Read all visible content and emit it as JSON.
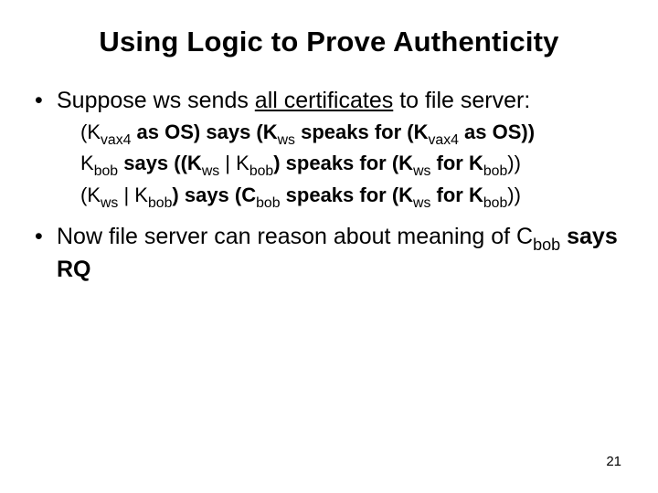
{
  "title": "Using Logic to Prove Authenticity",
  "bullet1": {
    "pre": "Suppose ws sends ",
    "underlined": "all certificates",
    "post": " to file server:"
  },
  "logic": {
    "l1": {
      "p1": "(K",
      "sub1": "vax4",
      "p2": " as OS) says (K",
      "sub2": "ws",
      "p3": " speaks for (K",
      "sub3": "vax4",
      "p4": " as OS))"
    },
    "l2": {
      "p1": "K",
      "sub1": "bob",
      "p2": " says ((K",
      "sub2": "ws",
      "p3": " | K",
      "sub3": "bob",
      "p4": ") speaks for (K",
      "sub4": "ws",
      "p5": " for K",
      "sub5": "bob",
      "p6": "))"
    },
    "l3": {
      "p1": "(K",
      "sub1": "ws",
      "p2": " | K",
      "sub2": "bob",
      "p3": ") says (C",
      "sub3": "bob",
      "p4": " speaks for (K",
      "sub4": "ws",
      "p5": " for K",
      "sub5": "bob",
      "p6": "))"
    }
  },
  "bullet2": {
    "p1": "Now file server can reason about meaning of C",
    "sub1": "bob",
    "p2": " says RQ"
  },
  "pagenum": "21"
}
